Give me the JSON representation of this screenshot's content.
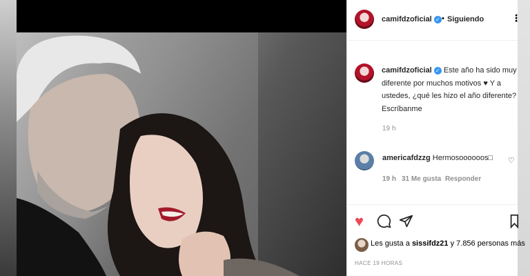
{
  "post": {
    "username": "camifdzoficial",
    "verified_badge": "✓",
    "separator": "•",
    "follow_status": "Siguiendo",
    "more_menu": "⋮"
  },
  "caption": {
    "username": "camifdzoficial",
    "text": "Este año ha sido muy diferente por muchos motivos ♥ Y a ustedes, ¿qué les hizo el año diferente? Escríbanme",
    "time": "19 h"
  },
  "comment": {
    "username": "americafdzzg",
    "text": "Hermosoooooos□",
    "time": "19 h",
    "likes": "31 Me gusta",
    "reply": "Responder"
  },
  "actions": {
    "like_icon": "♥",
    "comment_icon": "comment-icon",
    "share_icon": "share-icon",
    "save_icon": "bookmark-icon"
  },
  "likes": {
    "prefix": "Les gusta a ",
    "user": "sissifdz21",
    "suffix": " y 7.856 personas más"
  },
  "timestamp": "HACE 19 HORAS",
  "colors": {
    "like_red": "#ed4956",
    "verified_blue": "#3897f0",
    "muted_gray": "#8e8e8e"
  }
}
